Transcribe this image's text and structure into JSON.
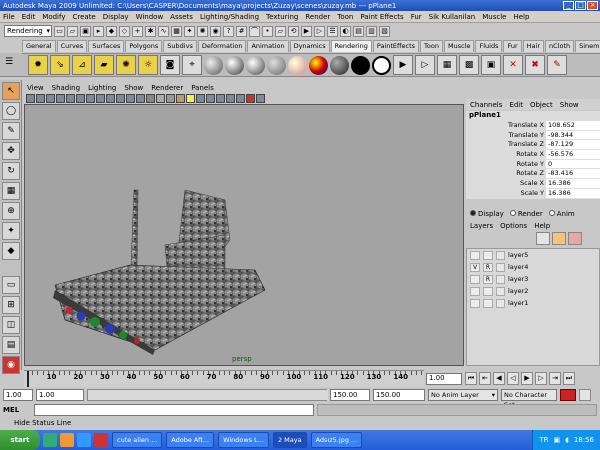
{
  "window": {
    "title": "Autodesk Maya 2009 Unlimited: C:\\Users\\CASPER\\Documents\\maya\\projects\\Zuzay\\scenes\\zuzay.mb  ---  pPlane1"
  },
  "menubar": {
    "items": [
      "File",
      "Edit",
      "Modify",
      "Create",
      "Display",
      "Window",
      "Assets",
      "Lighting/Shading",
      "Texturing",
      "Render",
      "Toon",
      "Paint Effects",
      "Fur",
      "Sik Kullanilan",
      "Muscle",
      "Help"
    ]
  },
  "statusline": {
    "mode": "Rendering"
  },
  "shelf": {
    "tabs": [
      "General",
      "Curves",
      "Surfaces",
      "Polygons",
      "Subdivs",
      "Deformation",
      "Animation",
      "Dynamics",
      "Rendering",
      "PaintEffects",
      "Toon",
      "Muscle",
      "Fluids",
      "Fur",
      "Hair",
      "nCloth",
      "Sinem",
      "ersin"
    ],
    "active_tab": "Rendering"
  },
  "panel": {
    "menu": [
      "View",
      "Shading",
      "Lighting",
      "Show",
      "Renderer",
      "Panels"
    ],
    "camera": "persp"
  },
  "channelbox": {
    "menu": [
      "Channels",
      "Edit",
      "Object",
      "Show"
    ],
    "object": "pPlane1",
    "attributes": [
      {
        "label": "Translate X",
        "value": "108.652"
      },
      {
        "label": "Translate Y",
        "value": "-98.344"
      },
      {
        "label": "Translate Z",
        "value": "-87.129"
      },
      {
        "label": "Rotate X",
        "value": "-56.576"
      },
      {
        "label": "Rotate Y",
        "value": "0"
      },
      {
        "label": "Rotate Z",
        "value": "-83.416"
      },
      {
        "label": "Scale X",
        "value": "16.386"
      },
      {
        "label": "Scale Y",
        "value": "16.386"
      }
    ]
  },
  "layers": {
    "modes": [
      "Display",
      "Render",
      "Anim"
    ],
    "active_mode": "Display",
    "menu": [
      "Layers",
      "Options",
      "Help"
    ],
    "items": [
      {
        "name": "layer5",
        "v": "",
        "r": ""
      },
      {
        "name": "layer4",
        "v": "V",
        "r": "R"
      },
      {
        "name": "layer3",
        "v": "",
        "r": "R"
      },
      {
        "name": "layer2",
        "v": "",
        "r": ""
      },
      {
        "name": "layer1",
        "v": "",
        "r": ""
      }
    ]
  },
  "timeline": {
    "ticks": [
      "10",
      "20",
      "30",
      "40",
      "50",
      "60",
      "70",
      "80",
      "90",
      "100",
      "110",
      "120",
      "130",
      "140"
    ],
    "current_frame": "1.00"
  },
  "range": {
    "start": "1.00",
    "start_inner": "1.00",
    "end_inner": "150.00",
    "end": "150.00",
    "anim_layer": "No Anim Layer",
    "char_set": "No Character Set"
  },
  "cmdline": {
    "label": "MEL"
  },
  "helpline": {
    "text": "Hide Status Line"
  },
  "taskbar": {
    "start": "start",
    "tasks": [
      "cute alien ...",
      "Adobe Aft...",
      "Windows L...",
      "2 Maya",
      "Adsız5.jpg ..."
    ],
    "active_task": "2 Maya",
    "lang": "TR",
    "clock": "18:56"
  }
}
